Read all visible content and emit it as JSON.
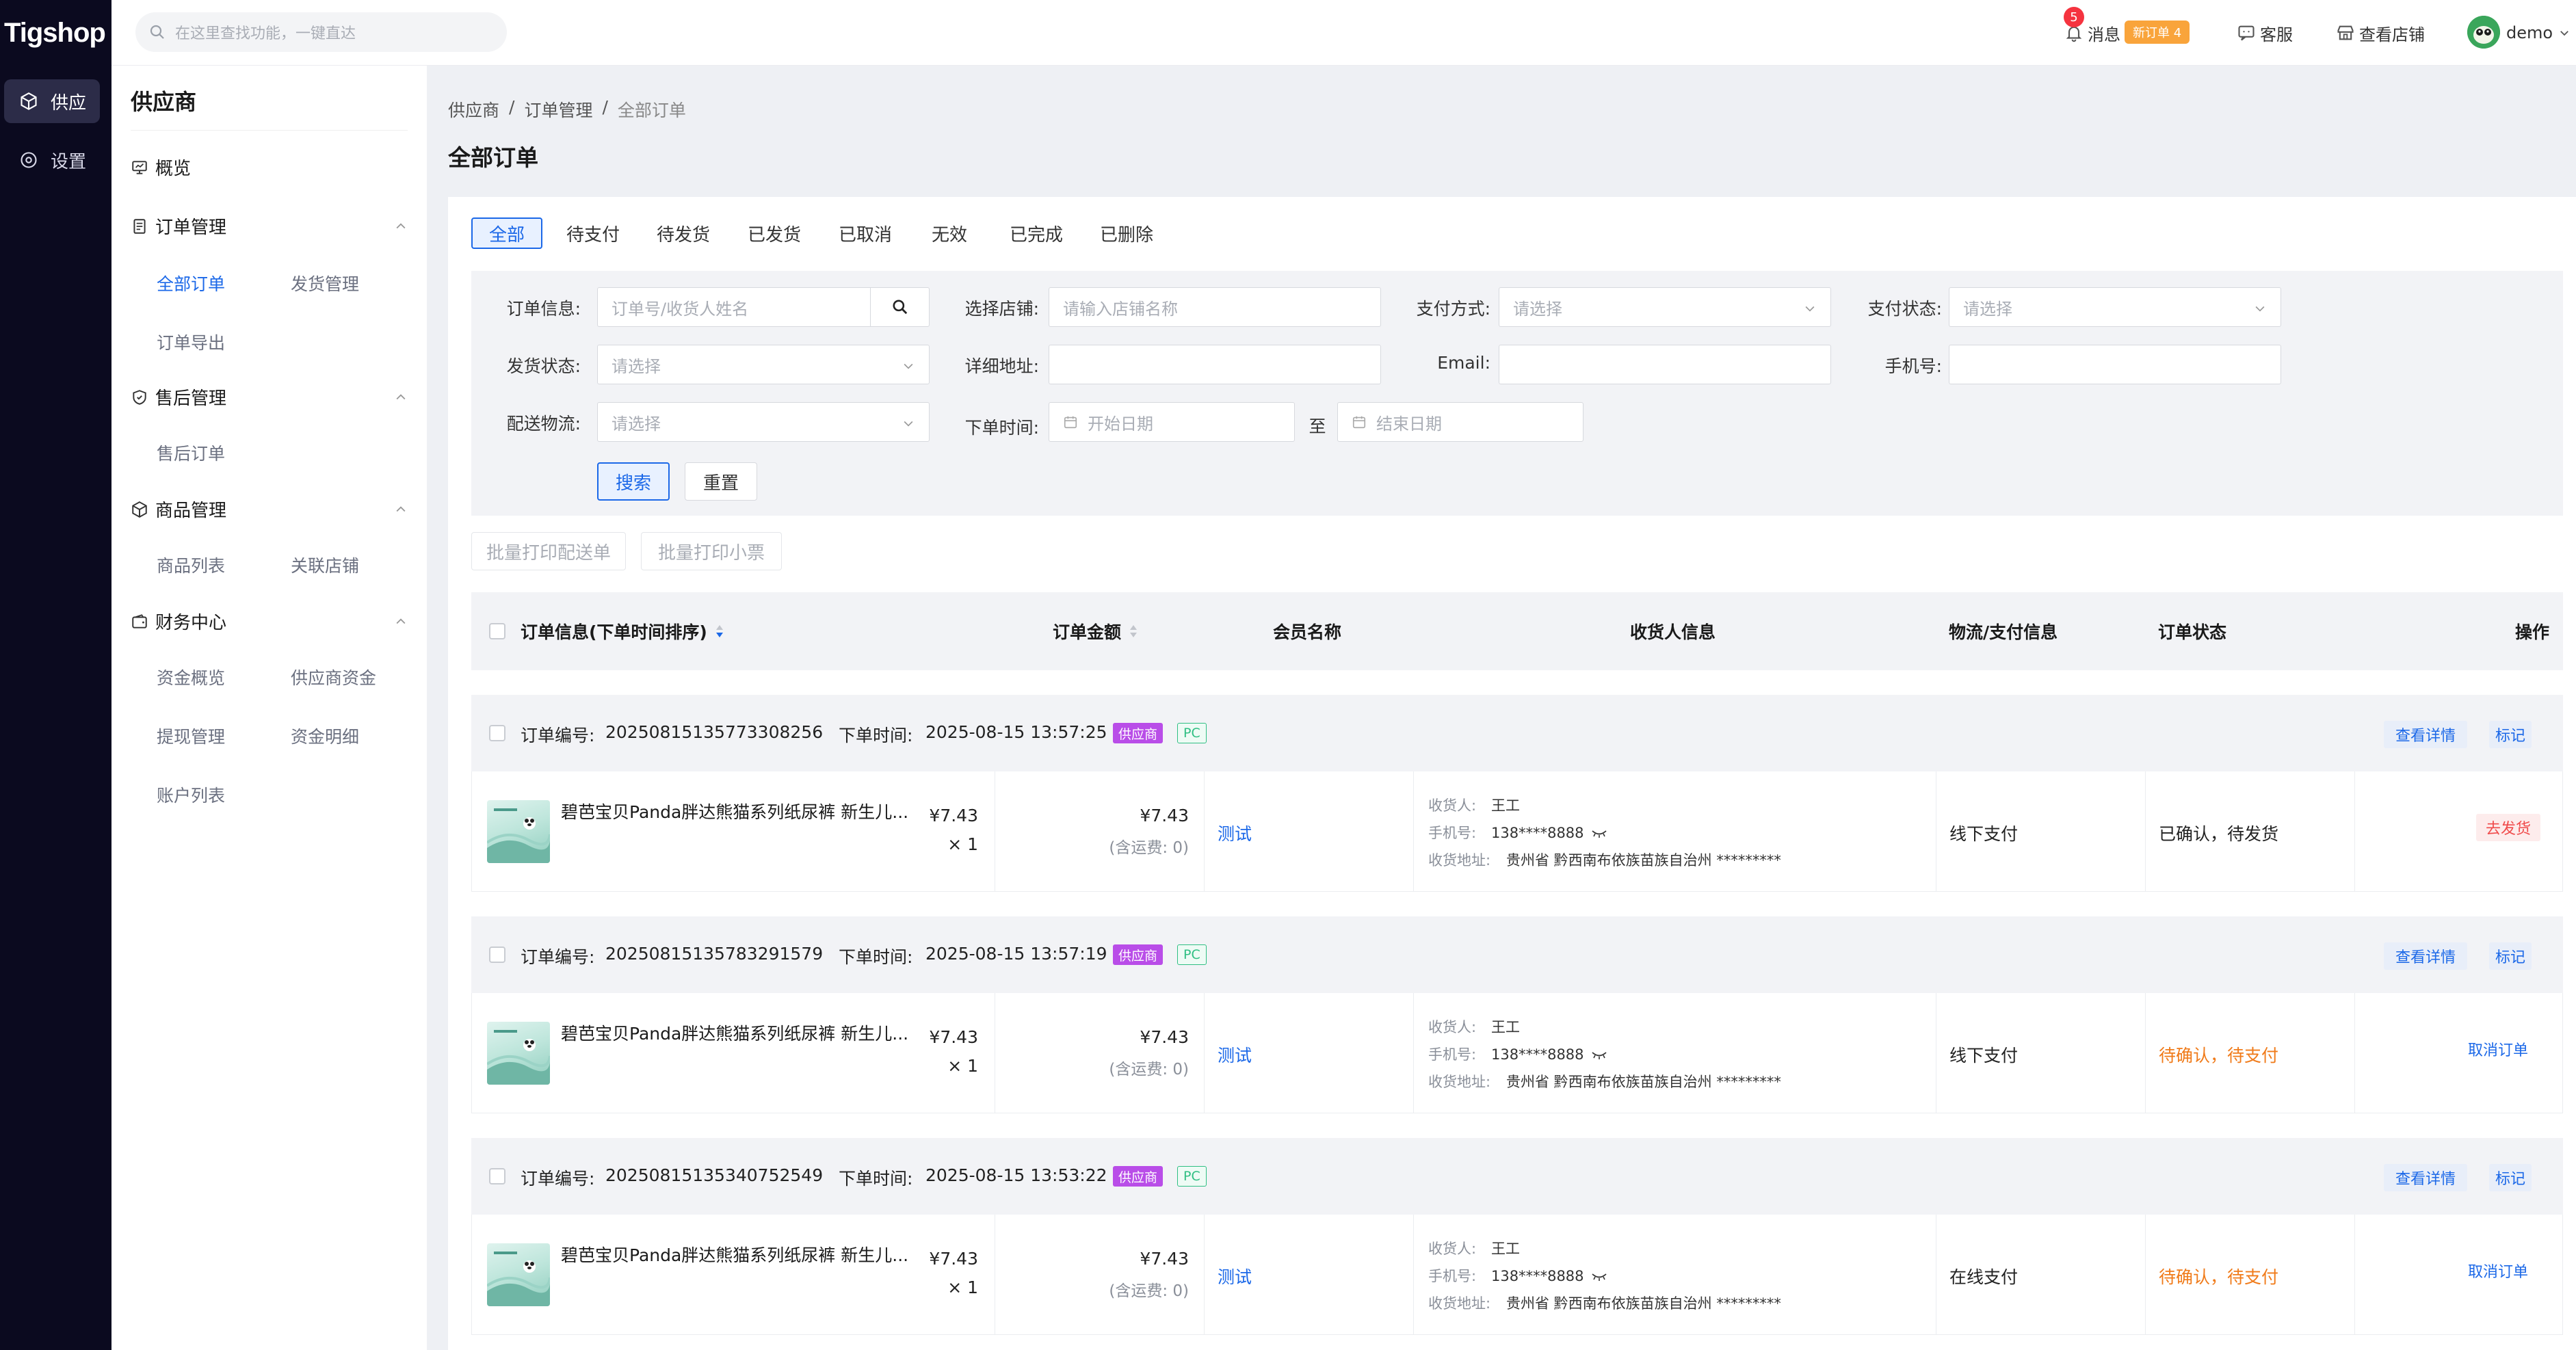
{
  "app": {
    "logo": "Tigshop"
  },
  "topbar": {
    "search_placeholder": "在这里查找功能，一键直达",
    "messages": {
      "label": "消息",
      "badge": "5",
      "new_order": "新订单 4"
    },
    "service": "客服",
    "view_store": "查看店铺",
    "user": "demo"
  },
  "darknav": [
    {
      "label": "供应",
      "icon": "cube-icon",
      "active": true
    },
    {
      "label": "设置",
      "icon": "settings-icon",
      "active": false
    }
  ],
  "subnav": {
    "title": "供应商",
    "overview": "概览",
    "groups": [
      {
        "label": "订单管理",
        "items": [
          "全部订单",
          "发货管理",
          "订单导出"
        ]
      },
      {
        "label": "售后管理",
        "items": [
          "售后订单"
        ]
      },
      {
        "label": "商品管理",
        "items": [
          "商品列表",
          "关联店铺"
        ]
      },
      {
        "label": "财务中心",
        "items": [
          "资金概览",
          "供应商资金",
          "提现管理",
          "资金明细",
          "账户列表"
        ]
      }
    ]
  },
  "breadcrumb": [
    "供应商",
    "订单管理",
    "全部订单"
  ],
  "breadcrumb_sep": "/",
  "page_title": "全部订单",
  "tabs": [
    "全部",
    "待支付",
    "待发货",
    "已发货",
    "已取消",
    "无效",
    "已完成",
    "已删除"
  ],
  "active_tab": 0,
  "filters": {
    "order_info": {
      "label": "订单信息:",
      "placeholder": "订单号/收货人姓名"
    },
    "store": {
      "label": "选择店铺:",
      "placeholder": "请输入店铺名称"
    },
    "pay_method": {
      "label": "支付方式:",
      "placeholder": "请选择"
    },
    "pay_status": {
      "label": "支付状态:",
      "placeholder": "请选择"
    },
    "ship_status": {
      "label": "发货状态:",
      "placeholder": "请选择"
    },
    "address": {
      "label": "详细地址:",
      "value": ""
    },
    "email": {
      "label": "Email:",
      "value": ""
    },
    "phone": {
      "label": "手机号:",
      "value": ""
    },
    "logistics": {
      "label": "配送物流:",
      "placeholder": "请选择"
    },
    "order_time": {
      "label": "下单时间:",
      "start": "开始日期",
      "to": "至",
      "end": "结束日期"
    },
    "search_btn": "搜索",
    "reset_btn": "重置"
  },
  "batch": {
    "print_delivery": "批量打印配送单",
    "print_receipt": "批量打印小票"
  },
  "table_headers": {
    "order_info": "订单信息(下单时间排序)",
    "amount": "订单金额",
    "member": "会员名称",
    "consignee": "收货人信息",
    "logistics": "物流/支付信息",
    "status": "订单状态",
    "action": "操作"
  },
  "order_labels": {
    "order_no": "订单编号:",
    "order_time": "下单时间:",
    "view_detail": "查看详情",
    "mark": "标记",
    "consignee": "收货人:",
    "phone": "手机号:",
    "address": "收货地址:",
    "shipping_note": "(含运费: 0)"
  },
  "orders": [
    {
      "order_no": "20250815135773308256",
      "time": "2025-08-15 13:57:25",
      "tags": [
        "供应商",
        "PC"
      ],
      "product": "碧芭宝贝Panda胖达熊猫系列纸尿裤 新生儿...",
      "price": "¥7.43",
      "qty": "× 1",
      "amount": "¥7.43",
      "member": "测试",
      "consignee": "王工",
      "phone": "138****8888",
      "address": "贵州省 黔西南布依族苗族自治州 *********",
      "payment": "线下支付",
      "status": "已确认，待发货",
      "status_color": "#222222",
      "action": "去发货",
      "action_color": "#f04b4b"
    },
    {
      "order_no": "20250815135783291579",
      "time": "2025-08-15 13:57:19",
      "tags": [
        "供应商",
        "PC"
      ],
      "product": "碧芭宝贝Panda胖达熊猫系列纸尿裤 新生儿...",
      "price": "¥7.43",
      "qty": "× 1",
      "amount": "¥7.43",
      "member": "测试",
      "consignee": "王工",
      "phone": "138****8888",
      "address": "贵州省 黔西南布依族苗族自治州 *********",
      "payment": "线下支付",
      "status": "待确认，待支付",
      "status_color": "#f07b1a",
      "action": "取消订单",
      "action_color": "#1b68e8"
    },
    {
      "order_no": "20250815135340752549",
      "time": "2025-08-15 13:53:22",
      "tags": [
        "供应商",
        "PC"
      ],
      "product": "碧芭宝贝Panda胖达熊猫系列纸尿裤 新生儿...",
      "price": "¥7.43",
      "qty": "× 1",
      "amount": "¥7.43",
      "member": "测试",
      "consignee": "王工",
      "phone": "138****8888",
      "address": "贵州省 黔西南布依族苗族自治州 *********",
      "payment": "在线支付",
      "status": "待确认，待支付",
      "status_color": "#f07b1a",
      "action": "取消订单",
      "action_color": "#1b68e8"
    }
  ],
  "colors": {
    "accent": "#1b68e8",
    "sidebar": "#0b0a1f",
    "supplier_tag": "#b94de8",
    "pc_tag": "#2fbf83"
  }
}
